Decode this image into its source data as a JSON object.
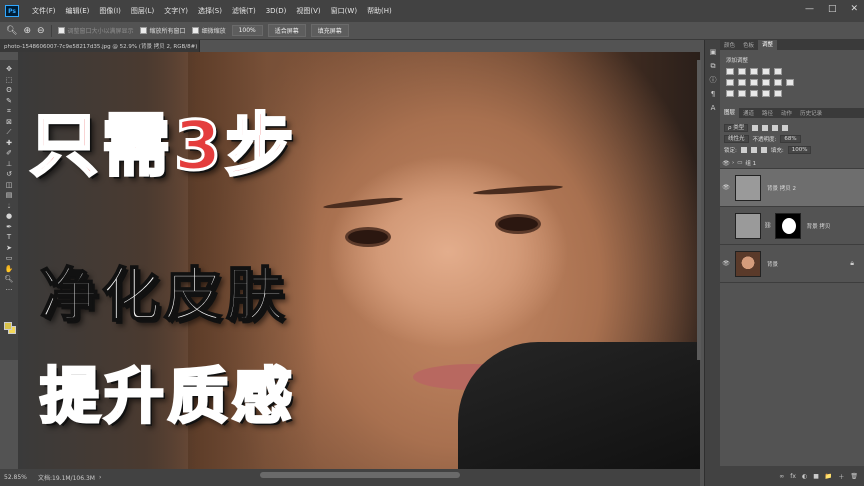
{
  "app": {
    "logo": "Ps"
  },
  "menu": [
    "文件(F)",
    "编辑(E)",
    "图像(I)",
    "图层(L)",
    "文字(Y)",
    "选择(S)",
    "滤镜(T)",
    "3D(D)",
    "视图(V)",
    "窗口(W)",
    "帮助(H)"
  ],
  "window_controls": [
    "—",
    "□",
    "✕"
  ],
  "options": {
    "tool_icon": "zoom-icon",
    "resize_windows_label": "调整窗口大小以满屏显示",
    "zoom_all_label": "缩放所有窗口",
    "scrubby_label": "细微缩放",
    "zoom_100": "100%",
    "fit_screen": "适合屏幕",
    "fill_screen": "填充屏幕"
  },
  "document": {
    "tab_title": "photo-1548606007-7c9e58217d35.jpg @ 52.9% (背景 拷贝 2, RGB/8#)",
    "close": "×"
  },
  "headline": {
    "line1": "只需3步",
    "line2": "净化皮肤",
    "line3": "提升质感"
  },
  "status": {
    "zoom": "52.85%",
    "doc": "文档:19.1M/106.3M",
    "arrow": "›"
  },
  "panels": {
    "top_tabs": [
      "颜色",
      "色板",
      "调整"
    ],
    "adjustments_title": "添加调整",
    "layers_tabs": [
      "图层",
      "通道",
      "路径",
      "动作",
      "历史记录"
    ],
    "kind_filter": "ρ 类型",
    "blend_mode": "线性光",
    "opacity_label": "不透明度:",
    "opacity_value": "68%",
    "lock_label": "锁定:",
    "fill_label": "填充:",
    "fill_value": "100%",
    "layers": [
      {
        "name": "组 1",
        "type": "group"
      },
      {
        "name": "背景 拷贝 2",
        "type": "layer",
        "selected": true
      },
      {
        "name": "背景 拷贝",
        "type": "masked"
      },
      {
        "name": "背景",
        "type": "background"
      }
    ],
    "footer_icons": [
      "∞",
      "fx",
      "◐",
      "■",
      "📁",
      "＋",
      "🗑"
    ]
  },
  "colors": {
    "foreground": "#d8c24a",
    "background": "#f2d75a",
    "title_red": "#e43d3d",
    "title_orange": "#f4892f"
  }
}
